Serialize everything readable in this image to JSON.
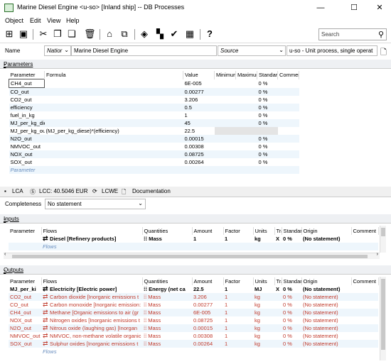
{
  "window": {
    "title": "Marine Diesel Engine <u-so> [Inland ship] -- DB Processes",
    "minimize": "—",
    "maximize": "☐",
    "close": "✕"
  },
  "menu": [
    "Object",
    "Edit",
    "View",
    "Help"
  ],
  "search": {
    "placeholder": "Search"
  },
  "name_row": {
    "label": "Name",
    "nation": "Natior",
    "name_value": "Marine Diesel Engine",
    "source": "Source",
    "type_value": "u-so - Unit process, single operat"
  },
  "parameters": {
    "section_label": "Parameters",
    "headers": [
      "Parameter",
      "Formula",
      "Value",
      "Minimum",
      "Maximum",
      "Standar",
      "Commer"
    ],
    "rows": [
      {
        "name": "CH4_out",
        "formula": "",
        "value": "6E-005",
        "std": "0 %"
      },
      {
        "name": "CO_out",
        "formula": "",
        "value": "0.00277",
        "std": "0 %"
      },
      {
        "name": "CO2_out",
        "formula": "",
        "value": "3.206",
        "std": "0 %"
      },
      {
        "name": "efficiency",
        "formula": "",
        "value": "0.5",
        "std": "0 %"
      },
      {
        "name": "fuel_in_kg",
        "formula": "",
        "value": "1",
        "std": "0 %"
      },
      {
        "name": "MJ_per_kg_die",
        "formula": "",
        "value": "45",
        "std": "0 %"
      },
      {
        "name": "MJ_per_kg_ou",
        "formula": "(MJ_per_kg_diese)*(efficiency)",
        "value": "22.5",
        "std": ""
      },
      {
        "name": "N2O_out",
        "formula": "",
        "value": "0.00015",
        "std": "0 %"
      },
      {
        "name": "NMVOC_out",
        "formula": "",
        "value": "0.00308",
        "std": "0 %"
      },
      {
        "name": "NOX_out",
        "formula": "",
        "value": "0.08725",
        "std": "0 %"
      },
      {
        "name": "SOX_out",
        "formula": "",
        "value": "0.00264",
        "std": "0 %"
      }
    ],
    "new_row_placeholder": "Parameter"
  },
  "tabs": {
    "lca": "LCA",
    "lcc": "LCC: 40.5046 EUR",
    "lcwe": "LCWE",
    "documentation": "Documentation"
  },
  "completeness": {
    "label": "Completeness",
    "value": "No statement"
  },
  "inputs": {
    "section_label": "Inputs",
    "headers": [
      "Parameter",
      "Flows",
      "Quantities",
      "Amount",
      "Factor",
      "Units",
      "Tra",
      "Standar",
      "Origin",
      "Comment"
    ],
    "rows": [
      {
        "param": "",
        "flow": "Diesel [Refinery products]",
        "qty": "Mass",
        "amount": "1",
        "factor": "1",
        "unit": "kg",
        "tr": "X",
        "std": "0 %",
        "origin": "(No statement)",
        "comment": ""
      }
    ],
    "new_row_placeholder": "Flows"
  },
  "outputs": {
    "section_label": "Outputs",
    "headers": [
      "Parameter",
      "Flows",
      "Quantities",
      "Amount",
      "Factor",
      "Units",
      "Tra",
      "Standar",
      "Origin",
      "Comment"
    ],
    "rows": [
      {
        "param": "MJ_per_ki",
        "flow": "Electricity [Electric power]",
        "qty": "Energy (net ca",
        "amount": "22.5",
        "factor": "1",
        "unit": "MJ",
        "tr": "X",
        "std": "0 %",
        "origin": "(No statement)",
        "bold": true
      },
      {
        "param": "CO2_out",
        "flow": "Carbon dioxide [Inorganic emissions t",
        "qty": "Mass",
        "amount": "3.206",
        "factor": "1",
        "unit": "kg",
        "tr": "",
        "std": "0 %",
        "origin": "(No statement)"
      },
      {
        "param": "CO_out",
        "flow": "Carbon monoxide [Inorganic emission:",
        "qty": "Mass",
        "amount": "0.00277",
        "factor": "1",
        "unit": "kg",
        "tr": "",
        "std": "0 %",
        "origin": "(No statement)"
      },
      {
        "param": "CH4_out",
        "flow": "Methane [Organic emissions to air (gr",
        "qty": "Mass",
        "amount": "6E-005",
        "factor": "1",
        "unit": "kg",
        "tr": "",
        "std": "0 %",
        "origin": "(No statement)"
      },
      {
        "param": "NOX_out",
        "flow": "Nitrogen oxides [Inorganic emissions t",
        "qty": "Mass",
        "amount": "0.08725",
        "factor": "1",
        "unit": "kg",
        "tr": "",
        "std": "0 %",
        "origin": "(No statement)"
      },
      {
        "param": "N2O_out",
        "flow": "Nitrous oxide (laughing gas) [Inorgan",
        "qty": "Mass",
        "amount": "0.00015",
        "factor": "1",
        "unit": "kg",
        "tr": "",
        "std": "0 %",
        "origin": "(No statement)"
      },
      {
        "param": "NMVOC_out",
        "flow": "NMVOC, non-methane volatile organic",
        "qty": "Mass",
        "amount": "0.00308",
        "factor": "1",
        "unit": "kg",
        "tr": "",
        "std": "0 %",
        "origin": "(No statement)"
      },
      {
        "param": "SOX_out",
        "flow": "Sulphur oxides [Inorganic emissions t",
        "qty": "Mass",
        "amount": "0.00264",
        "factor": "1",
        "unit": "kg",
        "tr": "",
        "std": "0 %",
        "origin": "(No statement)"
      }
    ],
    "new_row_placeholder": "Flows"
  },
  "colors": {
    "emission_text": "#c0392b",
    "stripe": "#eef6fc",
    "section_bg": "#eef0f3"
  }
}
